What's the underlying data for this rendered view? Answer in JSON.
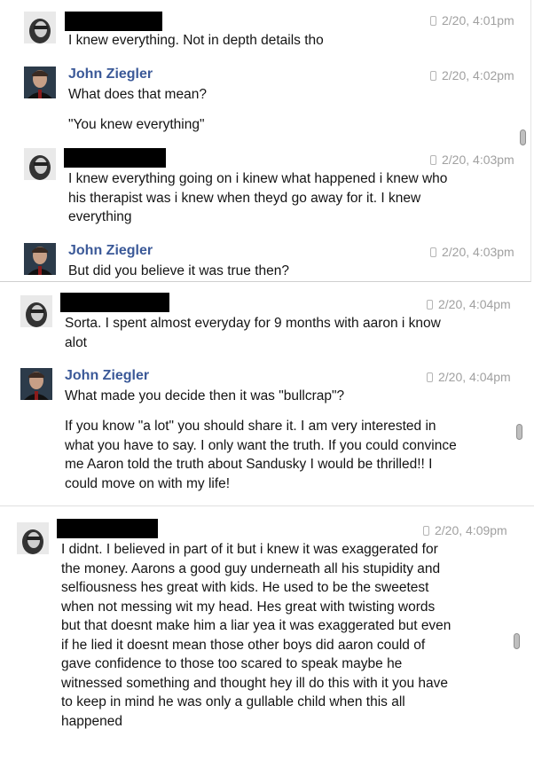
{
  "messages": [
    {
      "sender": "",
      "time": "2/20, 4:01pm",
      "lines": [
        "I knew everything. Not in depth details tho"
      ]
    },
    {
      "sender": "John Ziegler",
      "time": "2/20, 4:02pm",
      "lines": [
        "What does that mean?"
      ],
      "extra": "\"You knew everything\""
    },
    {
      "sender": "",
      "time": "2/20, 4:03pm",
      "lines": [
        "I knew everything going on i kinew what happened i knew who",
        "his therapist was i knew when theyd go away for it. I knew",
        "everything"
      ]
    },
    {
      "sender": "John Ziegler",
      "time": "2/20, 4:03pm",
      "lines": [
        "But did you believe it was true then?"
      ]
    },
    {
      "sender": "",
      "time": "2/20, 4:04pm",
      "lines": [
        "Sorta. I spent almost everyday for 9 months with aaron i know",
        "alot"
      ]
    },
    {
      "sender": "John Ziegler",
      "time": "2/20, 4:04pm",
      "lines": [
        "What made you decide then it was \"bullcrap\"?"
      ],
      "extra_lines": [
        "If you know \"a lot\" you should share it. I am very interested in",
        "what you have to say. I only want the truth. If you could convince",
        "me Aaron told the truth about Sandusky I would be thrilled!! I",
        "could move on with my life!"
      ]
    },
    {
      "sender": "",
      "time": "2/20, 4:09pm",
      "lines": [
        "I didnt. I believed in part of it but i knew it was exaggerated for",
        "the money. Aarons a good guy underneath all his stupidity and",
        "selfiousness hes great with kids. He used to be the sweetest",
        "when not messing wit my head. Hes great with twisting words",
        "but that doesnt make him a liar yea it was exaggerated but even",
        "if he lied it doesnt mean those other boys did aaron could of",
        "gave confidence to those too scared to speak maybe he",
        "witnessed something and thought hey ill do this with it you have",
        "to keep in mind he was only a gullable child when this all",
        "happened"
      ]
    }
  ],
  "icons": {
    "device": "mobile-phone-icon"
  },
  "colors": {
    "name": "#3b5998",
    "timestamp": "#a0a0a0",
    "redaction": "#000000"
  }
}
